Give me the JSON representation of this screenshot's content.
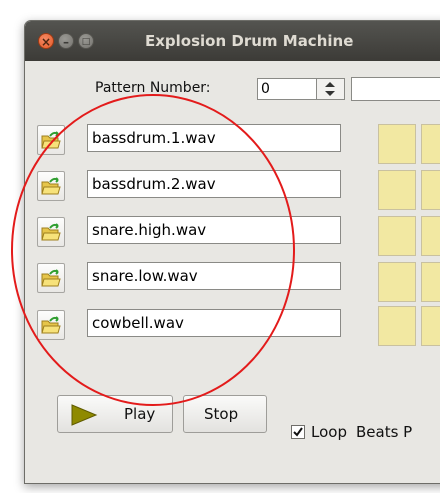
{
  "window": {
    "title": "Explosion Drum Machine"
  },
  "title_buttons": {
    "close": "×",
    "minimize": "–",
    "maximize": "□"
  },
  "pattern": {
    "label": "Pattern Number:",
    "value": "0"
  },
  "tracks": [
    {
      "file": "bassdrum.1.wav"
    },
    {
      "file": "bassdrum.2.wav"
    },
    {
      "file": "snare.high.wav"
    },
    {
      "file": "snare.low.wav"
    },
    {
      "file": "cowbell.wav"
    }
  ],
  "controls": {
    "play_label": "Play",
    "stop_label": "Stop",
    "loop_label": "Loop",
    "loop_checked": true,
    "beats_label": "Beats P"
  },
  "colors": {
    "title_bar": "#3c3b37",
    "beat_cell": "#f2e8a2",
    "annotation": "#e31b1b",
    "play_arrow": "#8f8a00"
  },
  "icons": {
    "open": "folder-open-icon",
    "play": "play-triangle-icon",
    "spin": "spin-arrows-icon",
    "check": "check-icon"
  }
}
